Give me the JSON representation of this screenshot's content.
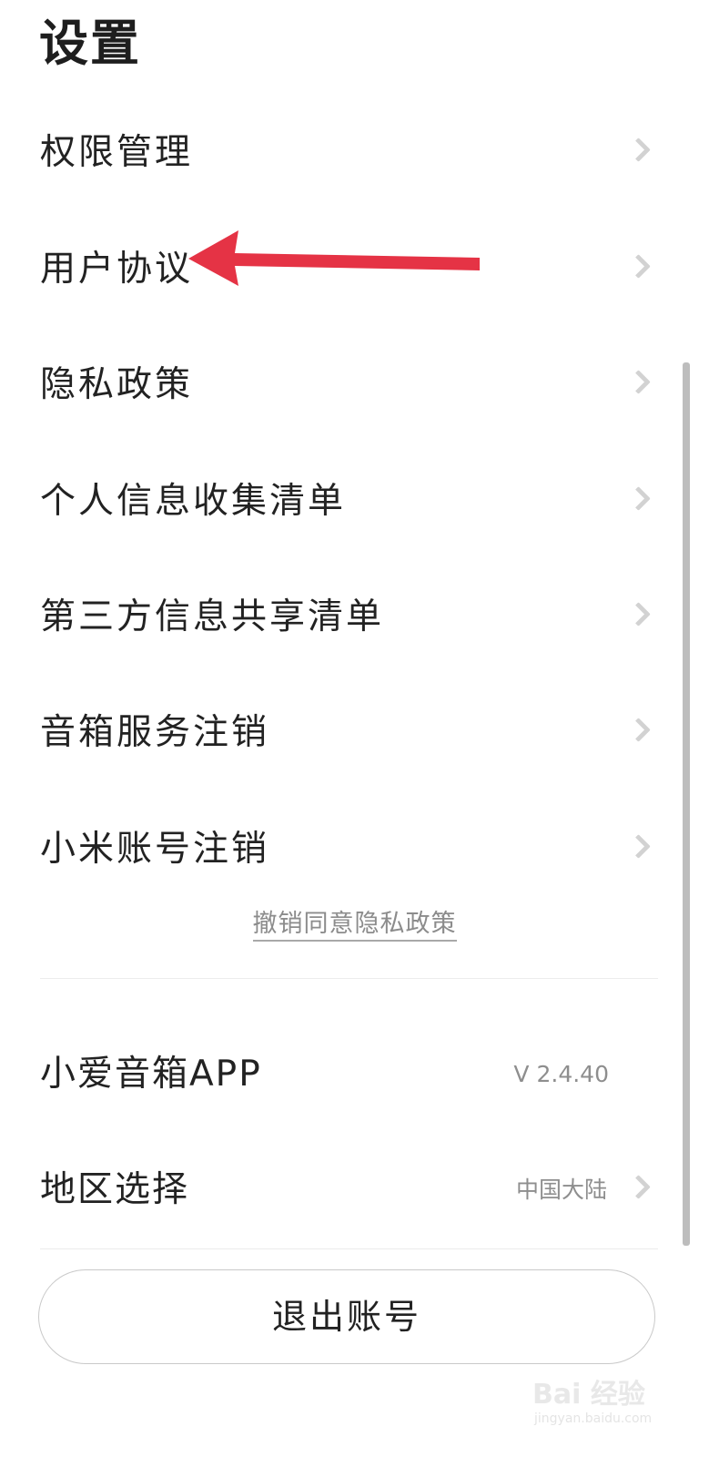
{
  "header": {
    "title": "设置"
  },
  "menu": {
    "items": [
      {
        "label": "权限管理"
      },
      {
        "label": "用户协议"
      },
      {
        "label": "隐私政策"
      },
      {
        "label": "个人信息收集清单"
      },
      {
        "label": "第三方信息共享清单"
      },
      {
        "label": "音箱服务注销"
      },
      {
        "label": "小米账号注销"
      }
    ]
  },
  "revoke_link": "撤销同意隐私政策",
  "app_info": {
    "label": "小爱音箱APP",
    "version": "V 2.4.40"
  },
  "region": {
    "label": "地区选择",
    "value": "中国大陆"
  },
  "logout_button": "退出账号",
  "annotation": {
    "arrow_color": "#e53345"
  },
  "watermark": {
    "text": "Bai 经验",
    "sub": "jingyan.baidu.com"
  }
}
